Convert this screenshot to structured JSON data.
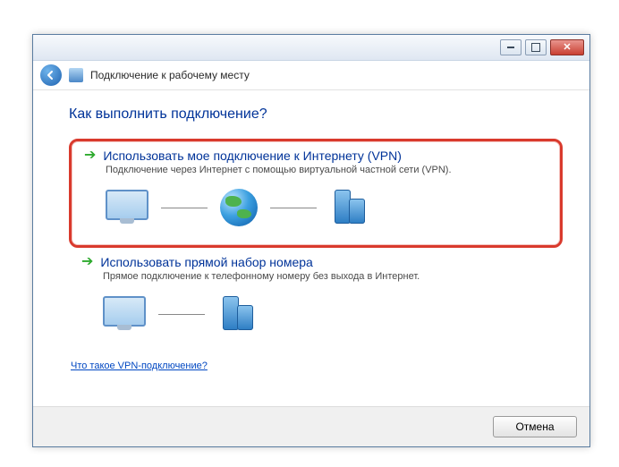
{
  "window_title": "Подключение к рабочему месту",
  "question": "Как выполнить подключение?",
  "options": [
    {
      "title": "Использовать мое подключение к Интернету (VPN)",
      "desc": "Подключение через Интернет с помощью виртуальной частной сети (VPN)."
    },
    {
      "title": "Использовать прямой набор номера",
      "desc": "Прямое подключение к телефонному номеру без выхода в Интернет."
    }
  ],
  "help_link": "Что такое VPN-подключение?",
  "footer": {
    "cancel": "Отмена"
  }
}
